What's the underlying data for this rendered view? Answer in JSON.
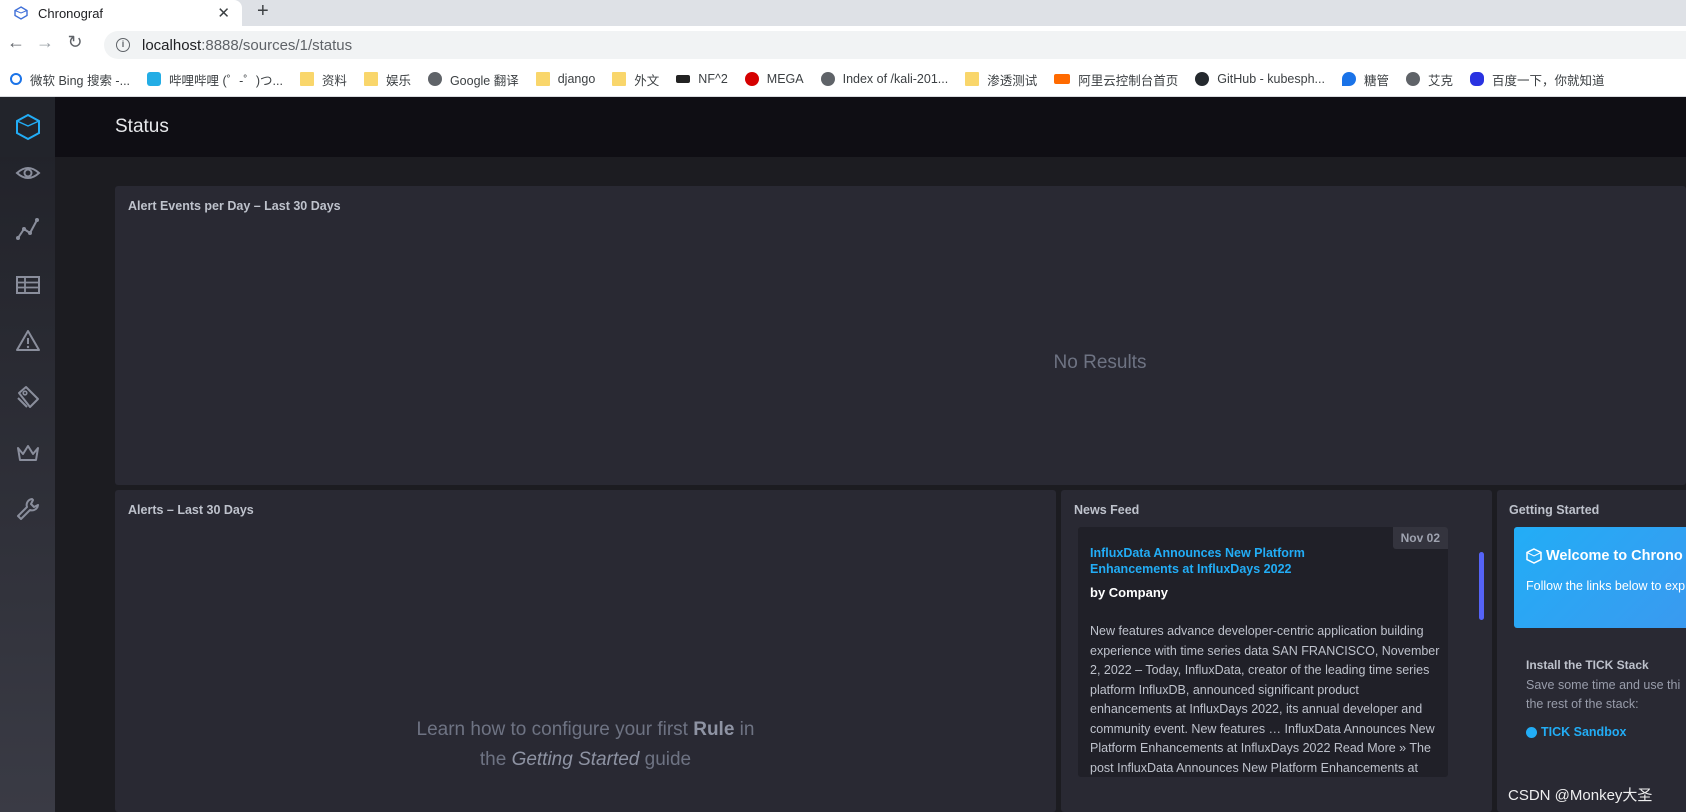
{
  "browser": {
    "tab_title": "Chronograf",
    "tab_close": "✕",
    "new_tab": "+",
    "url_host": "localhost",
    "url_path": ":8888/sources/1/status",
    "bookmarks": [
      {
        "label": "微软 Bing 搜索 -...",
        "icon": "search-icon"
      },
      {
        "label": "哔哩哔哩 (゜-゜)つ...",
        "icon": "bilibili-icon"
      },
      {
        "label": "资料",
        "icon": "folder-icon"
      },
      {
        "label": "娱乐",
        "icon": "folder-icon"
      },
      {
        "label": "Google 翻译",
        "icon": "globe-icon"
      },
      {
        "label": "django",
        "icon": "folder-icon"
      },
      {
        "label": "外文",
        "icon": "folder-icon"
      },
      {
        "label": "NF^2",
        "icon": "bow-icon"
      },
      {
        "label": "MEGA",
        "icon": "mega-icon"
      },
      {
        "label": "Index of /kali-201...",
        "icon": "globe-icon"
      },
      {
        "label": "渗透测试",
        "icon": "folder-icon"
      },
      {
        "label": "阿里云控制台首页",
        "icon": "aliyun-icon"
      },
      {
        "label": "GitHub - kubesph...",
        "icon": "github-icon"
      },
      {
        "label": "糖管",
        "icon": "drop-icon"
      },
      {
        "label": "艾克",
        "icon": "globe-icon"
      },
      {
        "label": "百度一下，你就知道",
        "icon": "baidu-icon"
      }
    ]
  },
  "header": {
    "title": "Status"
  },
  "alert_events_panel": {
    "title": "Alert Events per Day – Last 30 Days",
    "empty_text": "No Results"
  },
  "alerts_panel": {
    "title": "Alerts – Last 30 Days",
    "empty_line1_prefix": "Learn how to configure your first ",
    "empty_line1_bold": "Rule",
    "empty_line1_suffix": " in",
    "empty_line2_prefix": "the ",
    "empty_line2_italic": "Getting Started",
    "empty_line2_suffix": " guide"
  },
  "news_feed": {
    "title": "News Feed",
    "item": {
      "date": "Nov 02",
      "headline": "InfluxData Announces New Platform Enhancements at InfluxDays 2022",
      "author": "by Company",
      "body": "  New features advance developer-centric application building experience with time series data SAN FRANCISCO, November 2, 2022 – Today, InfluxData, creator of the leading time series platform InfluxDB, announced significant product enhancements at InfluxDays 2022, its annual developer and community event. New features … InfluxData Announces New Platform Enhancements at InfluxDays 2022 Read More » The post InfluxData Announces New Platform Enhancements at"
    }
  },
  "getting_started": {
    "title": "Getting Started",
    "welcome_title": "Welcome to Chrono",
    "welcome_text": "Follow the links below to exp features.",
    "install_heading": "Install the TICK Stack",
    "install_text": "Save some time and use thi the rest of the stack:",
    "sandbox_link": "TICK Sandbox"
  },
  "watermark": "CSDN @Monkey大圣",
  "colors": {
    "accent": "#22adf6",
    "panel": "#292933",
    "background": "#1c1c21"
  }
}
